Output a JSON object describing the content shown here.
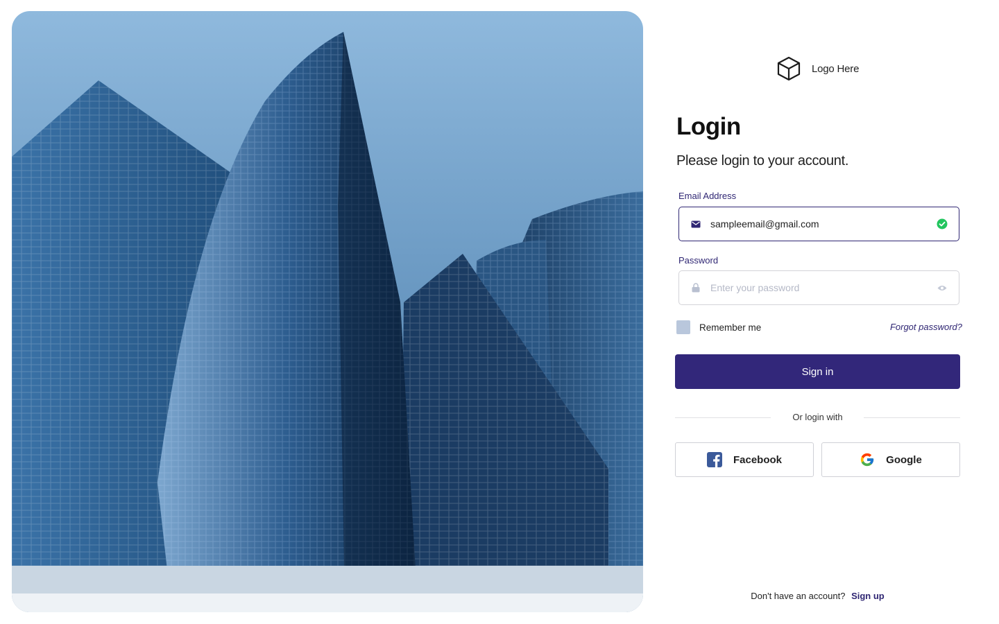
{
  "hero": {
    "image_alt": "Low-angle view of blue glass skyscrapers"
  },
  "logo": {
    "text": "Logo Here",
    "icon": "cube-icon"
  },
  "heading": {
    "title": "Login",
    "subtitle": "Please login to your account."
  },
  "email": {
    "label": "Email Address",
    "value": "sampleemail@gmail.com",
    "status": "valid"
  },
  "password": {
    "label": "Password",
    "placeholder": "Enter your password"
  },
  "remember": {
    "label": "Remember me",
    "checked": false
  },
  "forgot": {
    "label": "Forgot password?"
  },
  "signin": {
    "label": "Sign in"
  },
  "divider": {
    "label": "Or login with"
  },
  "social": {
    "facebook": "Facebook",
    "google": "Google"
  },
  "signup": {
    "prompt": "Don't have an account?",
    "link": "Sign up"
  },
  "colors": {
    "primary": "#32277a",
    "success": "#22c55e",
    "checkbox": "#b9c7dc"
  }
}
